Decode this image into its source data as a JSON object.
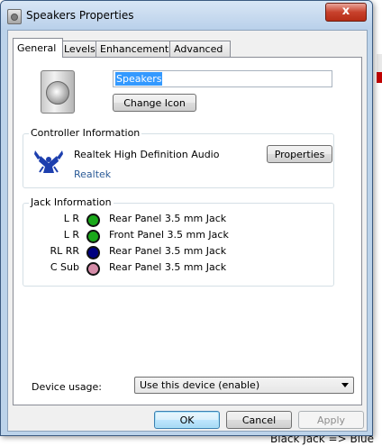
{
  "window": {
    "title": "Speakers Properties",
    "close_glyph": "x"
  },
  "tabs": [
    {
      "label": "General",
      "active": true
    },
    {
      "label": "Levels",
      "active": false
    },
    {
      "label": "Enhancements",
      "active": false
    },
    {
      "label": "Advanced",
      "active": false
    }
  ],
  "general": {
    "name_value": "Speakers",
    "change_icon_label": "Change Icon",
    "controller": {
      "section_title": "Controller Information",
      "name": "Realtek High Definition Audio",
      "vendor": "Realtek",
      "properties_label": "Properties"
    },
    "jack": {
      "section_title": "Jack Information",
      "rows": [
        {
          "channels": "L R",
          "color": "#1aa81a",
          "description": "Rear Panel 3.5 mm Jack"
        },
        {
          "channels": "L R",
          "color": "#1aa81a",
          "description": "Front Panel 3.5 mm Jack"
        },
        {
          "channels": "RL RR",
          "color": "#000080",
          "description": "Rear Panel 3.5 mm Jack"
        },
        {
          "channels": "C Sub",
          "color": "#d58ca8",
          "description": "Rear Panel 3.5 mm Jack"
        }
      ]
    },
    "device_usage": {
      "label": "Device usage:",
      "value": "Use this device (enable)"
    }
  },
  "buttons": {
    "ok": "OK",
    "cancel": "Cancel",
    "apply": "Apply"
  },
  "background": {
    "bottom_text": "Black Jack => Blue"
  }
}
